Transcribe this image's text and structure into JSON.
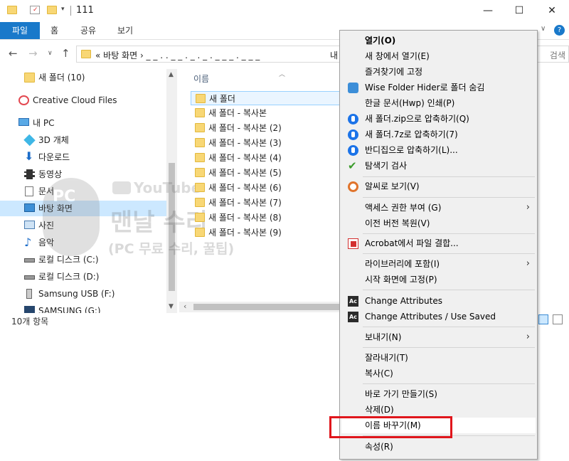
{
  "window": {
    "title": "111",
    "minimize": "—",
    "maximize": "☐",
    "close": "✕"
  },
  "ribbon": {
    "tabs": [
      "파일",
      "홈",
      "공유",
      "보기"
    ]
  },
  "address": {
    "path": "«  바탕 화면  ›  _ _ . . _ _ . _ . _ .  _ _ _ . _ _  _",
    "trailing": "내",
    "search_placeholder": "검색"
  },
  "navpane": {
    "items": [
      {
        "label": "새 폴더 (10)",
        "icon": "folder-icon"
      },
      {
        "label": "Creative Cloud Files",
        "icon": "creative-cloud-icon"
      },
      {
        "label": "내 PC",
        "icon": "pc-icon"
      },
      {
        "label": "3D 개체",
        "icon": "3d-objects-icon"
      },
      {
        "label": "다운로드",
        "icon": "download-icon"
      },
      {
        "label": "동영상",
        "icon": "video-icon"
      },
      {
        "label": "문서",
        "icon": "document-icon"
      },
      {
        "label": "바탕 화면",
        "icon": "desktop-icon"
      },
      {
        "label": "사진",
        "icon": "pictures-icon"
      },
      {
        "label": "음악",
        "icon": "music-icon"
      },
      {
        "label": "로컬 디스크 (C:)",
        "icon": "drive-icon"
      },
      {
        "label": "로컬 디스크 (D:)",
        "icon": "drive-icon"
      },
      {
        "label": "Samsung USB (F:)",
        "icon": "usb-drive-icon"
      },
      {
        "label": "SAMSUNG (G:)",
        "icon": "drive-icon"
      }
    ]
  },
  "filelist": {
    "column_name": "이름",
    "files": [
      "새 폴더",
      "새 폴더 - 복사본",
      "새 폴더 - 복사본 (2)",
      "새 폴더 - 복사본 (3)",
      "새 폴더 - 복사본 (4)",
      "새 폴더 - 복사본 (5)",
      "새 폴더 - 복사본 (6)",
      "새 폴더 - 복사본 (7)",
      "새 폴더 - 복사본 (8)",
      "새 폴더 - 복사본 (9)"
    ]
  },
  "status": {
    "count": "10개 항목"
  },
  "watermark": {
    "youtube": "YouTube",
    "logo": "PC",
    "main": "맨날 수리",
    "sub": "(PC 무료 수리, 꿀팁)"
  },
  "context_menu": {
    "items": [
      "열기(O)",
      "새 창에서 열기(E)",
      "즐겨찾기에 고정",
      "Wise Folder Hider로 폴더 숨김",
      "한글 문서(Hwp) 인쇄(P)",
      "새 폴더.zip으로 압축하기(Q)",
      "새 폴더.7z로 압축하기(7)",
      "반디집으로 압축하기(L)...",
      "탐색기 검사",
      "알씨로 보기(V)",
      "액세스 권한 부여 (G)",
      "이전 버전 복원(V)",
      "Acrobat에서 파일 결합...",
      "라이브러리에 포함(I)",
      "시작 화면에 고정(P)",
      "Change Attributes",
      "Change Attributes / Use Saved",
      "보내기(N)",
      "잘라내기(T)",
      "복사(C)",
      "바로 가기 만들기(S)",
      "삭제(D)",
      "이름 바꾸기(M)",
      "속성(R)"
    ],
    "icon_colors": {
      "bandizip": "#1b73e8",
      "scan": "#3a9b2a",
      "acrobat": "#d32f2f"
    }
  }
}
